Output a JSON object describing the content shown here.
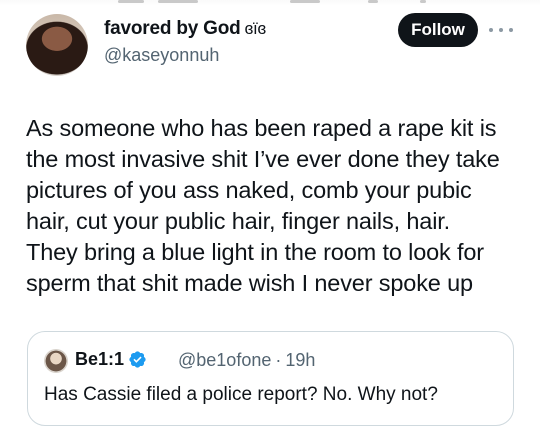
{
  "author": {
    "display_name": "favored by God",
    "name_glyphs": "ɞïɞ",
    "handle": "@kaseyonnuh"
  },
  "actions": {
    "follow_label": "Follow"
  },
  "tweet": {
    "lines": [
      "As someone who has been raped a rape kit is",
      "the most invasive shit I’ve ever done they take",
      "pictures of you ass naked, comb your pubic",
      "hair, cut your public hair, finger nails,  hair.",
      "They bring a blue light in the room to look for",
      "sperm that shit made wish I never spoke up"
    ]
  },
  "quoted_tweet": {
    "display_name": "Be1:1",
    "handle": "@be1ofone",
    "separator": "·",
    "time": "19h",
    "text": "Has Cassie filed a police report?  No. Why not?"
  },
  "colors": {
    "text_primary": "#0f1419",
    "text_secondary": "#536471",
    "verified_blue": "#1d9bf0",
    "border": "#cfd9de"
  },
  "icons": {
    "more": "more-dots-icon",
    "verified": "verified-badge-icon"
  }
}
